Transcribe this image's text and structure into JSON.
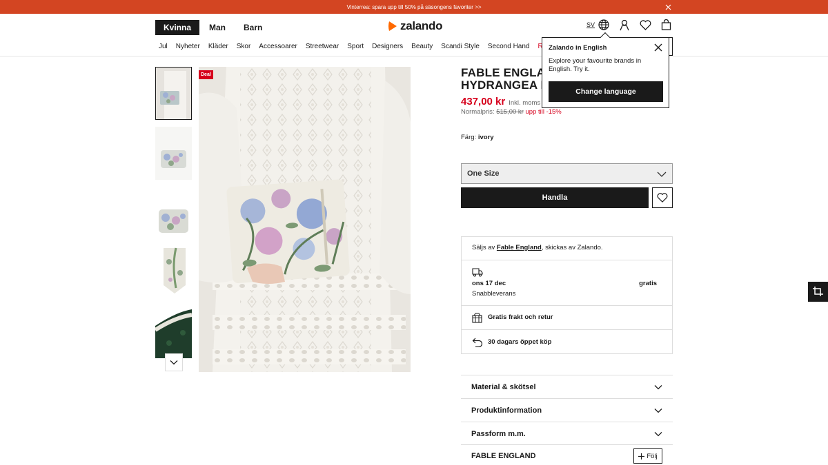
{
  "promo": {
    "text": "Vinterrea: spara upp till 50% på säsongens favoriter >>"
  },
  "header": {
    "gender_tabs": [
      "Kvinna",
      "Man",
      "Barn"
    ],
    "logo_text": "zalando",
    "language": "SV"
  },
  "nav": {
    "items": [
      "Jul",
      "Nyheter",
      "Kläder",
      "Skor",
      "Accessoarer",
      "Streetwear",
      "Sport",
      "Designers",
      "Beauty",
      "Scandi Style",
      "Second Hand",
      "Rea"
    ]
  },
  "popover": {
    "title": "Zalando in English",
    "text": "Explore your favourite brands in English. Try it.",
    "button": "Change language"
  },
  "gallery": {
    "deal_badge": "Deal"
  },
  "product": {
    "title_line1": "FABLE ENGLAN",
    "title_line2": "HYDRANGEA L",
    "price": "437,00 kr",
    "vat": "Inkl. moms",
    "normal_label": "Normalpris:",
    "normal_price": "515,00 kr",
    "discount": "upp till -15%",
    "color_label": "Färg:",
    "color_value": "ivory",
    "size": "One Size",
    "buy_label": "Handla"
  },
  "delivery": {
    "sold_prefix": "Säljs av",
    "seller": "Fable England",
    "sold_suffix": ", skickas av Zalando.",
    "date": "ons 17 dec",
    "method": "Snabbleverans",
    "cost": "gratis",
    "free_returns": "Gratis frakt och retur",
    "return_policy": "30 dagars öppet köp"
  },
  "accordions": [
    "Material & skötsel",
    "Produktinformation",
    "Passform m.m."
  ],
  "brand": {
    "name": "FABLE ENGLAND",
    "follow": "Följ"
  },
  "colors": {
    "accent": "#d34522",
    "sale": "#d6001c",
    "dark": "#1a1a1a"
  }
}
